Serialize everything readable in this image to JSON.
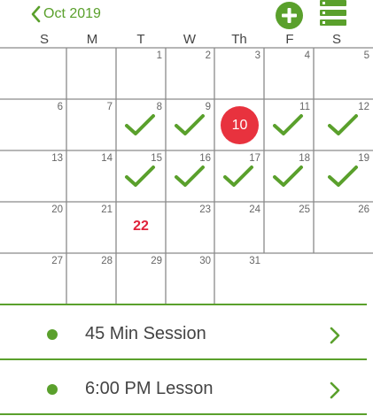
{
  "header": {
    "month_label": "Oct 2019",
    "accent_color": "#5aa02c",
    "back_icon": "chevron-left-icon",
    "add_icon": "plus-circle-icon",
    "menu_icon": "list-menu-icon"
  },
  "calendar": {
    "weekdays": [
      "S",
      "M",
      "T",
      "W",
      "Th",
      "F",
      "S"
    ],
    "today": 10,
    "today_color": "#e8323e",
    "highlighted_day": 22,
    "highlight_color": "#e0223a",
    "checked_days": [
      8,
      9,
      11,
      12,
      15,
      16,
      17,
      18,
      19
    ],
    "check_icon": "checkmark-icon",
    "days": [
      1,
      2,
      3,
      4,
      5,
      6,
      7,
      8,
      9,
      10,
      11,
      12,
      13,
      14,
      15,
      16,
      17,
      18,
      19,
      20,
      21,
      22,
      23,
      24,
      25,
      26,
      27,
      28,
      29,
      30,
      31
    ]
  },
  "sessions": [
    {
      "label": "45 Min Session",
      "dot_icon": "bullet-dot-icon",
      "chevron_icon": "chevron-right-icon"
    },
    {
      "label": "6:00 PM Lesson",
      "dot_icon": "bullet-dot-icon",
      "chevron_icon": "chevron-right-icon"
    }
  ]
}
